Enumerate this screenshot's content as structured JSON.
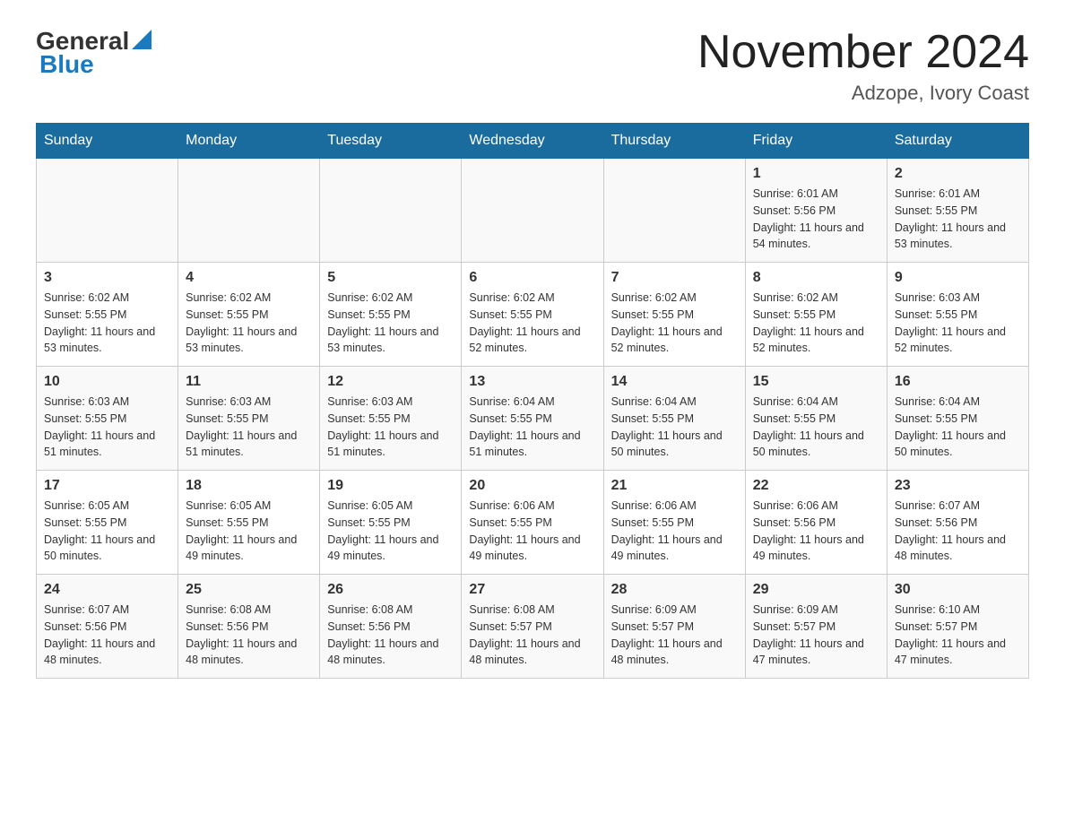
{
  "header": {
    "logo_general": "General",
    "logo_blue": "Blue",
    "month_title": "November 2024",
    "location": "Adzope, Ivory Coast"
  },
  "weekdays": [
    "Sunday",
    "Monday",
    "Tuesday",
    "Wednesday",
    "Thursday",
    "Friday",
    "Saturday"
  ],
  "weeks": [
    [
      {
        "day": "",
        "sunrise": "",
        "sunset": "",
        "daylight": ""
      },
      {
        "day": "",
        "sunrise": "",
        "sunset": "",
        "daylight": ""
      },
      {
        "day": "",
        "sunrise": "",
        "sunset": "",
        "daylight": ""
      },
      {
        "day": "",
        "sunrise": "",
        "sunset": "",
        "daylight": ""
      },
      {
        "day": "",
        "sunrise": "",
        "sunset": "",
        "daylight": ""
      },
      {
        "day": "1",
        "sunrise": "Sunrise: 6:01 AM",
        "sunset": "Sunset: 5:56 PM",
        "daylight": "Daylight: 11 hours and 54 minutes."
      },
      {
        "day": "2",
        "sunrise": "Sunrise: 6:01 AM",
        "sunset": "Sunset: 5:55 PM",
        "daylight": "Daylight: 11 hours and 53 minutes."
      }
    ],
    [
      {
        "day": "3",
        "sunrise": "Sunrise: 6:02 AM",
        "sunset": "Sunset: 5:55 PM",
        "daylight": "Daylight: 11 hours and 53 minutes."
      },
      {
        "day": "4",
        "sunrise": "Sunrise: 6:02 AM",
        "sunset": "Sunset: 5:55 PM",
        "daylight": "Daylight: 11 hours and 53 minutes."
      },
      {
        "day": "5",
        "sunrise": "Sunrise: 6:02 AM",
        "sunset": "Sunset: 5:55 PM",
        "daylight": "Daylight: 11 hours and 53 minutes."
      },
      {
        "day": "6",
        "sunrise": "Sunrise: 6:02 AM",
        "sunset": "Sunset: 5:55 PM",
        "daylight": "Daylight: 11 hours and 52 minutes."
      },
      {
        "day": "7",
        "sunrise": "Sunrise: 6:02 AM",
        "sunset": "Sunset: 5:55 PM",
        "daylight": "Daylight: 11 hours and 52 minutes."
      },
      {
        "day": "8",
        "sunrise": "Sunrise: 6:02 AM",
        "sunset": "Sunset: 5:55 PM",
        "daylight": "Daylight: 11 hours and 52 minutes."
      },
      {
        "day": "9",
        "sunrise": "Sunrise: 6:03 AM",
        "sunset": "Sunset: 5:55 PM",
        "daylight": "Daylight: 11 hours and 52 minutes."
      }
    ],
    [
      {
        "day": "10",
        "sunrise": "Sunrise: 6:03 AM",
        "sunset": "Sunset: 5:55 PM",
        "daylight": "Daylight: 11 hours and 51 minutes."
      },
      {
        "day": "11",
        "sunrise": "Sunrise: 6:03 AM",
        "sunset": "Sunset: 5:55 PM",
        "daylight": "Daylight: 11 hours and 51 minutes."
      },
      {
        "day": "12",
        "sunrise": "Sunrise: 6:03 AM",
        "sunset": "Sunset: 5:55 PM",
        "daylight": "Daylight: 11 hours and 51 minutes."
      },
      {
        "day": "13",
        "sunrise": "Sunrise: 6:04 AM",
        "sunset": "Sunset: 5:55 PM",
        "daylight": "Daylight: 11 hours and 51 minutes."
      },
      {
        "day": "14",
        "sunrise": "Sunrise: 6:04 AM",
        "sunset": "Sunset: 5:55 PM",
        "daylight": "Daylight: 11 hours and 50 minutes."
      },
      {
        "day": "15",
        "sunrise": "Sunrise: 6:04 AM",
        "sunset": "Sunset: 5:55 PM",
        "daylight": "Daylight: 11 hours and 50 minutes."
      },
      {
        "day": "16",
        "sunrise": "Sunrise: 6:04 AM",
        "sunset": "Sunset: 5:55 PM",
        "daylight": "Daylight: 11 hours and 50 minutes."
      }
    ],
    [
      {
        "day": "17",
        "sunrise": "Sunrise: 6:05 AM",
        "sunset": "Sunset: 5:55 PM",
        "daylight": "Daylight: 11 hours and 50 minutes."
      },
      {
        "day": "18",
        "sunrise": "Sunrise: 6:05 AM",
        "sunset": "Sunset: 5:55 PM",
        "daylight": "Daylight: 11 hours and 49 minutes."
      },
      {
        "day": "19",
        "sunrise": "Sunrise: 6:05 AM",
        "sunset": "Sunset: 5:55 PM",
        "daylight": "Daylight: 11 hours and 49 minutes."
      },
      {
        "day": "20",
        "sunrise": "Sunrise: 6:06 AM",
        "sunset": "Sunset: 5:55 PM",
        "daylight": "Daylight: 11 hours and 49 minutes."
      },
      {
        "day": "21",
        "sunrise": "Sunrise: 6:06 AM",
        "sunset": "Sunset: 5:55 PM",
        "daylight": "Daylight: 11 hours and 49 minutes."
      },
      {
        "day": "22",
        "sunrise": "Sunrise: 6:06 AM",
        "sunset": "Sunset: 5:56 PM",
        "daylight": "Daylight: 11 hours and 49 minutes."
      },
      {
        "day": "23",
        "sunrise": "Sunrise: 6:07 AM",
        "sunset": "Sunset: 5:56 PM",
        "daylight": "Daylight: 11 hours and 48 minutes."
      }
    ],
    [
      {
        "day": "24",
        "sunrise": "Sunrise: 6:07 AM",
        "sunset": "Sunset: 5:56 PM",
        "daylight": "Daylight: 11 hours and 48 minutes."
      },
      {
        "day": "25",
        "sunrise": "Sunrise: 6:08 AM",
        "sunset": "Sunset: 5:56 PM",
        "daylight": "Daylight: 11 hours and 48 minutes."
      },
      {
        "day": "26",
        "sunrise": "Sunrise: 6:08 AM",
        "sunset": "Sunset: 5:56 PM",
        "daylight": "Daylight: 11 hours and 48 minutes."
      },
      {
        "day": "27",
        "sunrise": "Sunrise: 6:08 AM",
        "sunset": "Sunset: 5:57 PM",
        "daylight": "Daylight: 11 hours and 48 minutes."
      },
      {
        "day": "28",
        "sunrise": "Sunrise: 6:09 AM",
        "sunset": "Sunset: 5:57 PM",
        "daylight": "Daylight: 11 hours and 48 minutes."
      },
      {
        "day": "29",
        "sunrise": "Sunrise: 6:09 AM",
        "sunset": "Sunset: 5:57 PM",
        "daylight": "Daylight: 11 hours and 47 minutes."
      },
      {
        "day": "30",
        "sunrise": "Sunrise: 6:10 AM",
        "sunset": "Sunset: 5:57 PM",
        "daylight": "Daylight: 11 hours and 47 minutes."
      }
    ]
  ]
}
